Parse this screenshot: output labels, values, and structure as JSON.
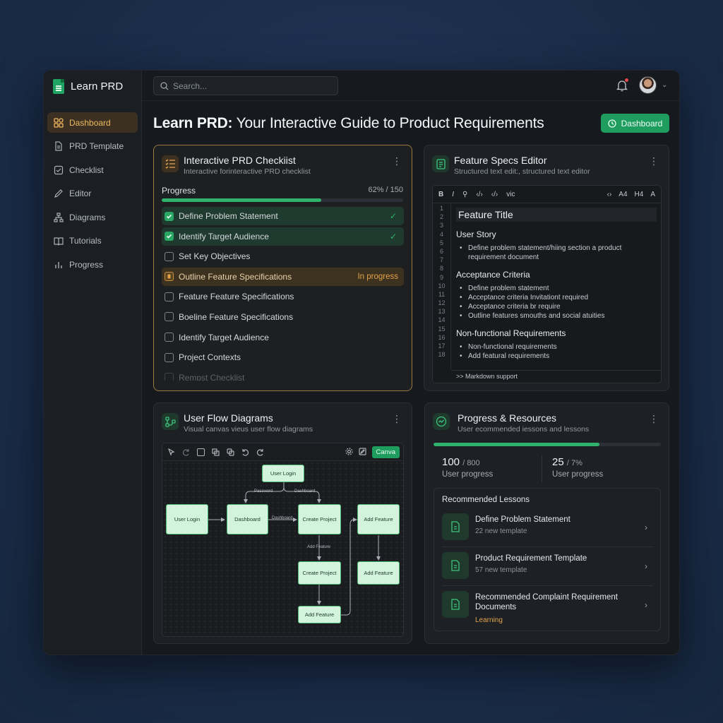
{
  "brand": {
    "name": "Learn PRD"
  },
  "sidebar": {
    "items": [
      {
        "label": "Dashboard",
        "icon": "grid-icon",
        "active": true
      },
      {
        "label": "PRD Template",
        "icon": "document-icon"
      },
      {
        "label": "Checklist",
        "icon": "checkbox-icon"
      },
      {
        "label": "Editor",
        "icon": "pencil-icon"
      },
      {
        "label": "Diagrams",
        "icon": "flow-icon"
      },
      {
        "label": "Tutorials",
        "icon": "book-icon"
      },
      {
        "label": "Progress",
        "icon": "bar-chart-icon"
      }
    ]
  },
  "topbar": {
    "search_placeholder": "Search..."
  },
  "header": {
    "title_bold": "Learn PRD:",
    "title_rest": " Your Interactive Guide to Product Requirements",
    "button_label": "Dashboard"
  },
  "checklist": {
    "title": "Interactive PRD Checkiist",
    "subtitle": "Interactive forinteractive PRD checklist",
    "progress_label": "Progress",
    "progress_value": "62% / 150",
    "progress_fraction": 0.66,
    "items": [
      {
        "label": "Define Problem Statement",
        "state": "done"
      },
      {
        "label": "Identify Target Audience",
        "state": "done"
      },
      {
        "label": "Set Key Objectives",
        "state": "todo"
      },
      {
        "label": "Outline Feature Specifications",
        "state": "progress",
        "status": "In progress"
      },
      {
        "label": "Feature Feature Specifications",
        "state": "todo"
      },
      {
        "label": "Boeline Feature Specifications",
        "state": "todo"
      },
      {
        "label": "Identify Target Audience",
        "state": "todo"
      },
      {
        "label": "Project Contexts",
        "state": "todo"
      },
      {
        "label": "Rempst Checklist",
        "state": "faded"
      }
    ]
  },
  "editor": {
    "title": "Feature Specs Editor",
    "subtitle": "Structured text edit:, structured text editor",
    "toolbar_left": [
      "B",
      "I",
      "⚲",
      "‹/›",
      "‹/›",
      "vic"
    ],
    "toolbar_right": [
      "‹›",
      "A4",
      "H4",
      "A"
    ],
    "line_numbers": [
      "1",
      "2",
      "3",
      "4",
      "5",
      "6",
      "7",
      "8",
      "9",
      "10",
      "11",
      "12",
      "13",
      "14",
      "15",
      "16",
      "17",
      "18"
    ],
    "heading": "Feature Title",
    "sections": [
      {
        "heading": "User Story",
        "bullets": [
          "Define problem statement/hiing section a product requirement document"
        ]
      },
      {
        "heading": "Acceptance Criteria",
        "bullets": [
          "Define problem statement",
          "Acceptance criteria Invitationt required",
          "Acceptance criteria br require",
          "Outline features smouths and social atuities"
        ]
      },
      {
        "heading": "Non-functional Requirements",
        "bullets": [
          "Non-functional requirements",
          "Add featural requirements"
        ]
      }
    ],
    "footer": ">>  Markdown support"
  },
  "flow": {
    "title": "User Flow Diagrams",
    "subtitle": "Visual canvas vieus user flow diagrams",
    "canva_label": "Canva",
    "nodes": {
      "top_login": "User Login",
      "left_login": "User Login",
      "dashboard": "Dashboard",
      "create_project": "Create Project",
      "add_feature_right": "Add Feature",
      "create_project_2": "Create Project",
      "add_feature_mid": "Add Feature",
      "add_feature_bottom": "Add Feature"
    },
    "edge_labels": {
      "password": "Password",
      "dashboard_top": "Dashboard",
      "dashboard_mid": "Dashboard",
      "add_feature": "Add Feature"
    }
  },
  "resources": {
    "title": "Progress & Resources",
    "subtitle": "User ecommended iessons and lessons",
    "progress_fraction": 0.73,
    "stat1_value": "100",
    "stat1_total": "/ 800",
    "stat1_label": "User progress",
    "stat2_value": "25",
    "stat2_total": "/ 7%",
    "stat2_label": "User progress",
    "lessons_title": "Recommended Lessons",
    "lessons": [
      {
        "title": "Define Problem Statement",
        "meta": "22 new template"
      },
      {
        "title": "Product Requirement Template",
        "meta": "57 new template"
      },
      {
        "title": "Recommended Complaint Requirement Documents",
        "meta": "Learning"
      }
    ]
  },
  "colors": {
    "accent": "#1e9d5e",
    "warning": "#e3a349",
    "panel": "#1d2024",
    "background": "#1b2d48"
  }
}
